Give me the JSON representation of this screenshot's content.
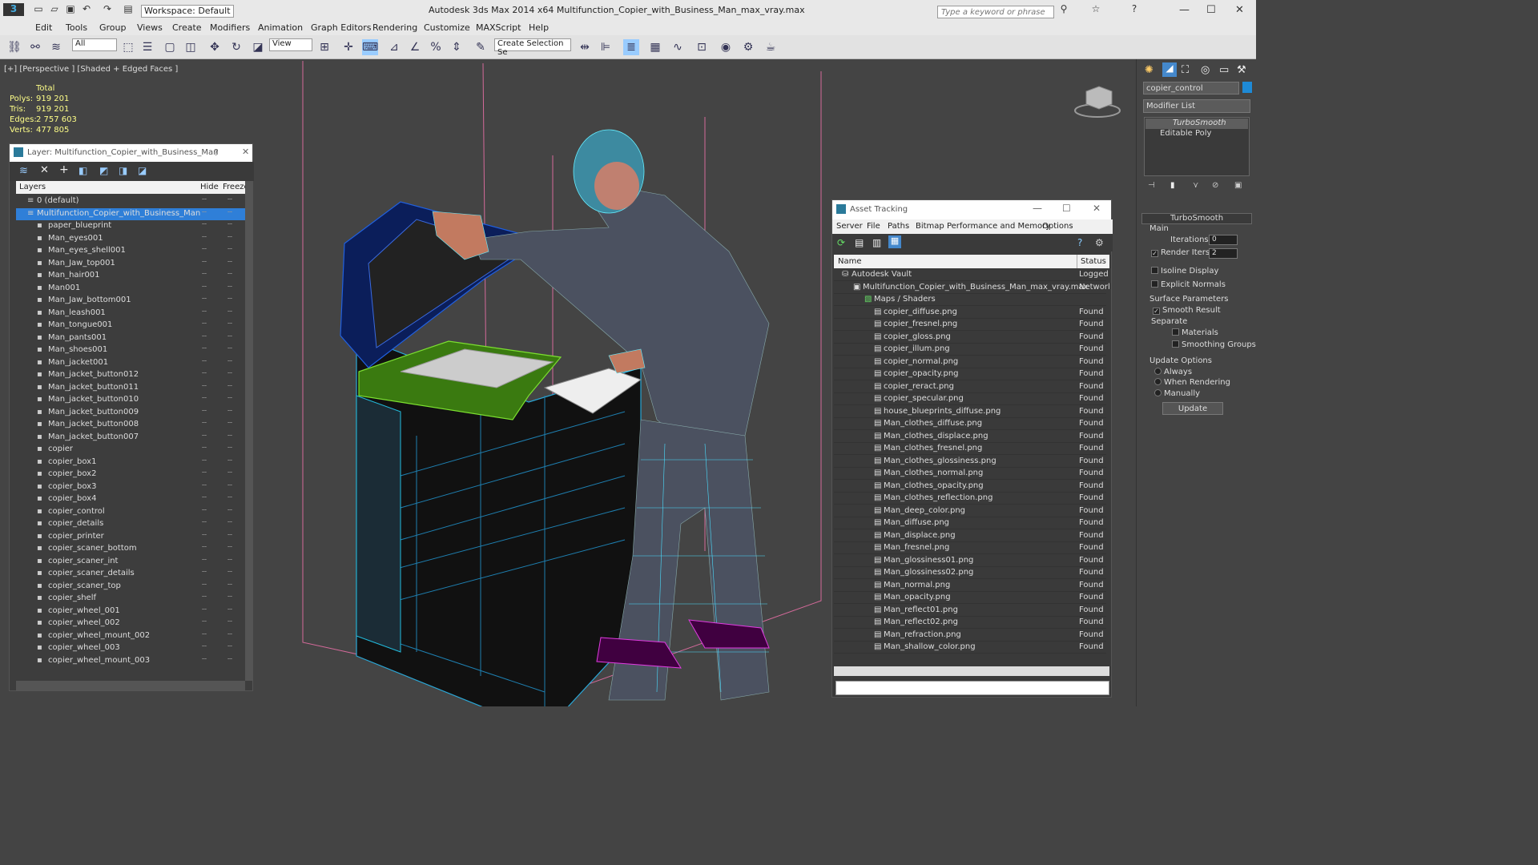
{
  "app": {
    "title": "Autodesk 3ds Max  2014 x64     Multifunction_Copier_with_Business_Man_max_vray.max",
    "workspace": "Workspace: Default",
    "search_placeholder": "Type a keyword or phrase"
  },
  "menu": [
    "Edit",
    "Tools",
    "Group",
    "Views",
    "Create",
    "Modifiers",
    "Animation",
    "Graph Editors",
    "Rendering",
    "Customize",
    "MAXScript",
    "Help"
  ],
  "toolbar": {
    "filter": "All",
    "refcoord": "View",
    "selection_set": "Create Selection Se"
  },
  "viewport": {
    "label": "[+] [Perspective ] [Shaded + Edged Faces ]",
    "stats": {
      "header": "Total",
      "polys_label": "Polys:",
      "polys": "919 201",
      "tris_label": "Tris:",
      "tris": "919 201",
      "edges_label": "Edges:",
      "edges": "2 757 603",
      "verts_label": "Verts:",
      "verts": "477 805"
    }
  },
  "layer_panel": {
    "title": "Layer: Multifunction_Copier_with_Business_Man",
    "help": "?",
    "close": "✕",
    "col_layers": "Layers",
    "col_hide": "Hide",
    "col_freeze": "Freeze",
    "rows": [
      "0 (default)",
      "Multifunction_Copier_with_Business_Man",
      "paper_blueprint",
      "Man_eyes001",
      "Man_eyes_shell001",
      "Man_Jaw_top001",
      "Man_hair001",
      "Man001",
      "Man_Jaw_bottom001",
      "Man_leash001",
      "Man_tongue001",
      "Man_pants001",
      "Man_shoes001",
      "Man_jacket001",
      "Man_jacket_button012",
      "Man_jacket_button011",
      "Man_jacket_button010",
      "Man_jacket_button009",
      "Man_jacket_button008",
      "Man_jacket_button007",
      "copier",
      "copier_box1",
      "copier_box2",
      "copier_box3",
      "copier_box4",
      "copier_control",
      "copier_details",
      "copier_printer",
      "copier_scaner_bottom",
      "copier_scaner_int",
      "copier_scaner_details",
      "copier_scaner_top",
      "copier_shelf",
      "copier_wheel_001",
      "copier_wheel_002",
      "copier_wheel_mount_002",
      "copier_wheel_003",
      "copier_wheel_mount_003"
    ]
  },
  "asset_panel": {
    "title": "Asset Tracking",
    "menu": [
      "Server",
      "File",
      "Paths",
      "Bitmap Performance and Memory",
      "Options"
    ],
    "col_name": "Name",
    "col_status": "Status",
    "rows": [
      {
        "name": "Autodesk Vault",
        "status": "Logged"
      },
      {
        "name": "Multifunction_Copier_with_Business_Man_max_vray.max",
        "status": "Network"
      },
      {
        "name": "Maps / Shaders",
        "status": ""
      },
      {
        "name": "copier_diffuse.png",
        "status": "Found"
      },
      {
        "name": "copier_fresnel.png",
        "status": "Found"
      },
      {
        "name": "copier_gloss.png",
        "status": "Found"
      },
      {
        "name": "copier_illum.png",
        "status": "Found"
      },
      {
        "name": "copier_normal.png",
        "status": "Found"
      },
      {
        "name": "copier_opacity.png",
        "status": "Found"
      },
      {
        "name": "copier_reract.png",
        "status": "Found"
      },
      {
        "name": "copier_specular.png",
        "status": "Found"
      },
      {
        "name": "house_blueprints_diffuse.png",
        "status": "Found"
      },
      {
        "name": "Man_clothes_diffuse.png",
        "status": "Found"
      },
      {
        "name": "Man_clothes_displace.png",
        "status": "Found"
      },
      {
        "name": "Man_clothes_fresnel.png",
        "status": "Found"
      },
      {
        "name": "Man_clothes_glossiness.png",
        "status": "Found"
      },
      {
        "name": "Man_clothes_normal.png",
        "status": "Found"
      },
      {
        "name": "Man_clothes_opacity.png",
        "status": "Found"
      },
      {
        "name": "Man_clothes_reflection.png",
        "status": "Found"
      },
      {
        "name": "Man_deep_color.png",
        "status": "Found"
      },
      {
        "name": "Man_diffuse.png",
        "status": "Found"
      },
      {
        "name": "Man_displace.png",
        "status": "Found"
      },
      {
        "name": "Man_fresnel.png",
        "status": "Found"
      },
      {
        "name": "Man_glossiness01.png",
        "status": "Found"
      },
      {
        "name": "Man_glossiness02.png",
        "status": "Found"
      },
      {
        "name": "Man_normal.png",
        "status": "Found"
      },
      {
        "name": "Man_opacity.png",
        "status": "Found"
      },
      {
        "name": "Man_reflect01.png",
        "status": "Found"
      },
      {
        "name": "Man_reflect02.png",
        "status": "Found"
      },
      {
        "name": "Man_refraction.png",
        "status": "Found"
      },
      {
        "name": "Man_shallow_color.png",
        "status": "Found"
      }
    ]
  },
  "command_panel": {
    "object_name": "copier_control",
    "modifier_list": "Modifier List",
    "stack": [
      "TurboSmooth",
      "Editable Poly"
    ],
    "rollout": "TurboSmooth",
    "main": "Main",
    "iterations_label": "Iterations:",
    "iterations": "0",
    "render_iters_label": "Render Iters:",
    "render_iters": "2",
    "isoline": "Isoline Display",
    "explicit": "Explicit Normals",
    "surface": "Surface Parameters",
    "smooth_result": "Smooth Result",
    "separate": "Separate",
    "materials": "Materials",
    "smoothing_groups": "Smoothing Groups",
    "update_options": "Update Options",
    "always": "Always",
    "when_rendering": "When Rendering",
    "manually": "Manually",
    "update_button": "Update"
  }
}
